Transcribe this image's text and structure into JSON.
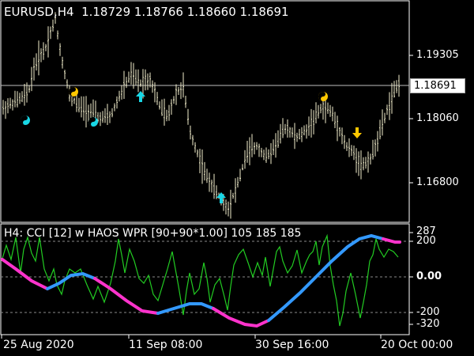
{
  "main_chart": {
    "symbol_timeframe": "EURUSD,H4",
    "ohlc": [
      "1.18729",
      "1.18766",
      "1.18660",
      "1.18691"
    ],
    "price_axis": [
      "1.19305",
      "1.18691",
      "1.18060",
      "1.16800"
    ],
    "current_price": "1.18691",
    "colors": {
      "bars": "#f2eecb",
      "price_line": "#bfbfbf",
      "signal_cyan": "#19d7e6",
      "signal_gold": "#ffc800"
    },
    "signals": [
      {
        "type": "yin-yang-cyan-icon"
      },
      {
        "type": "yin-yang-gold-icon"
      },
      {
        "type": "yin-yang-cyan-icon"
      },
      {
        "type": "up-arrow-cyan-icon"
      },
      {
        "type": "up-arrow-cyan-icon"
      },
      {
        "type": "yin-yang-gold-icon"
      },
      {
        "type": "down-arrow-gold-icon"
      }
    ]
  },
  "indicator": {
    "title": "H4: CCI [12] w HAOS WPR [90+90*1.00] 105 185 185",
    "axis": [
      "287",
      "200",
      "0.00",
      "-200",
      "-320"
    ],
    "levels": [
      200,
      0,
      -200
    ],
    "colors": {
      "cci": "#22cc22",
      "trend_up": "#3399ff",
      "trend_down": "#ff33cc"
    }
  },
  "time_axis": [
    "25 Aug 2020",
    "11 Sep 08:00",
    "30 Sep 16:00",
    "20 Oct 00:00"
  ]
}
